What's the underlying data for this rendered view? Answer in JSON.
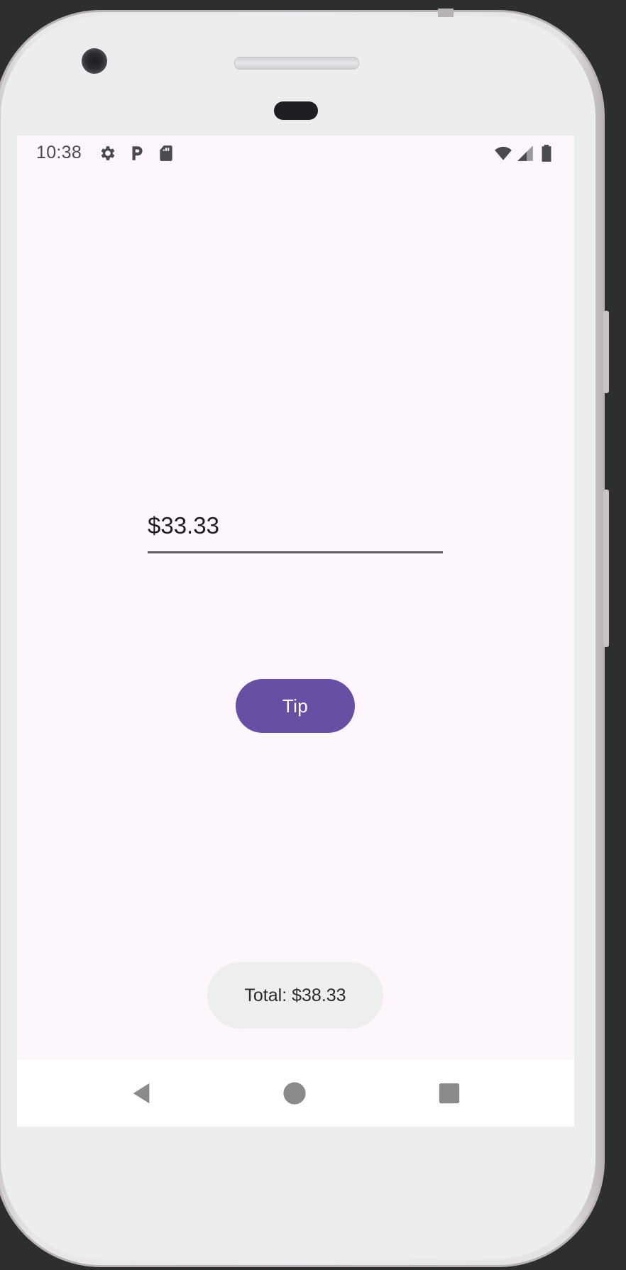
{
  "status_bar": {
    "time": "10:38",
    "icons": [
      "gear-icon",
      "parking-icon",
      "sd-card-icon",
      "wifi-icon",
      "signal-icon",
      "battery-icon"
    ]
  },
  "bill_input": {
    "value": "$33.33"
  },
  "tip_button": {
    "label": "Tip"
  },
  "toast": {
    "text": "Total: $38.33"
  },
  "nav_bar": {
    "icons": [
      "back-icon",
      "home-icon",
      "recents-icon"
    ]
  },
  "colors": {
    "accent": "#6750a4",
    "screen_background": "#fdf7fd",
    "toast_background": "#eeeeee"
  }
}
